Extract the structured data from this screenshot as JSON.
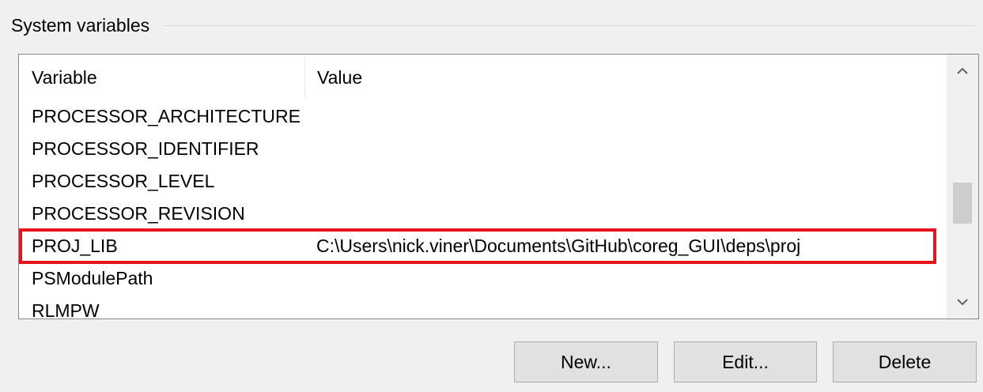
{
  "group": {
    "title": "System variables"
  },
  "table": {
    "columns": {
      "variable": "Variable",
      "value": "Value"
    },
    "rows": [
      {
        "variable": "PROCESSOR_ARCHITECTURE",
        "value": ""
      },
      {
        "variable": "PROCESSOR_IDENTIFIER",
        "value": ""
      },
      {
        "variable": "PROCESSOR_LEVEL",
        "value": ""
      },
      {
        "variable": "PROCESSOR_REVISION",
        "value": ""
      },
      {
        "variable": "PROJ_LIB",
        "value": "C:\\Users\\nick.viner\\Documents\\GitHub\\coreg_GUI\\deps\\proj",
        "highlighted": true
      },
      {
        "variable": "PSModulePath",
        "value": ""
      },
      {
        "variable": "RLMPW",
        "value": ""
      }
    ]
  },
  "scrollbar": {
    "up_icon": "chevron-up-icon",
    "down_icon": "chevron-down-icon"
  },
  "buttons": {
    "new_label": "New...",
    "edit_label": "Edit...",
    "delete_label": "Delete"
  },
  "colors": {
    "highlight_outline": "#e8141c",
    "window_bg": "#f0f0f0",
    "list_bg": "#ffffff",
    "button_bg": "#e1e1e1"
  }
}
